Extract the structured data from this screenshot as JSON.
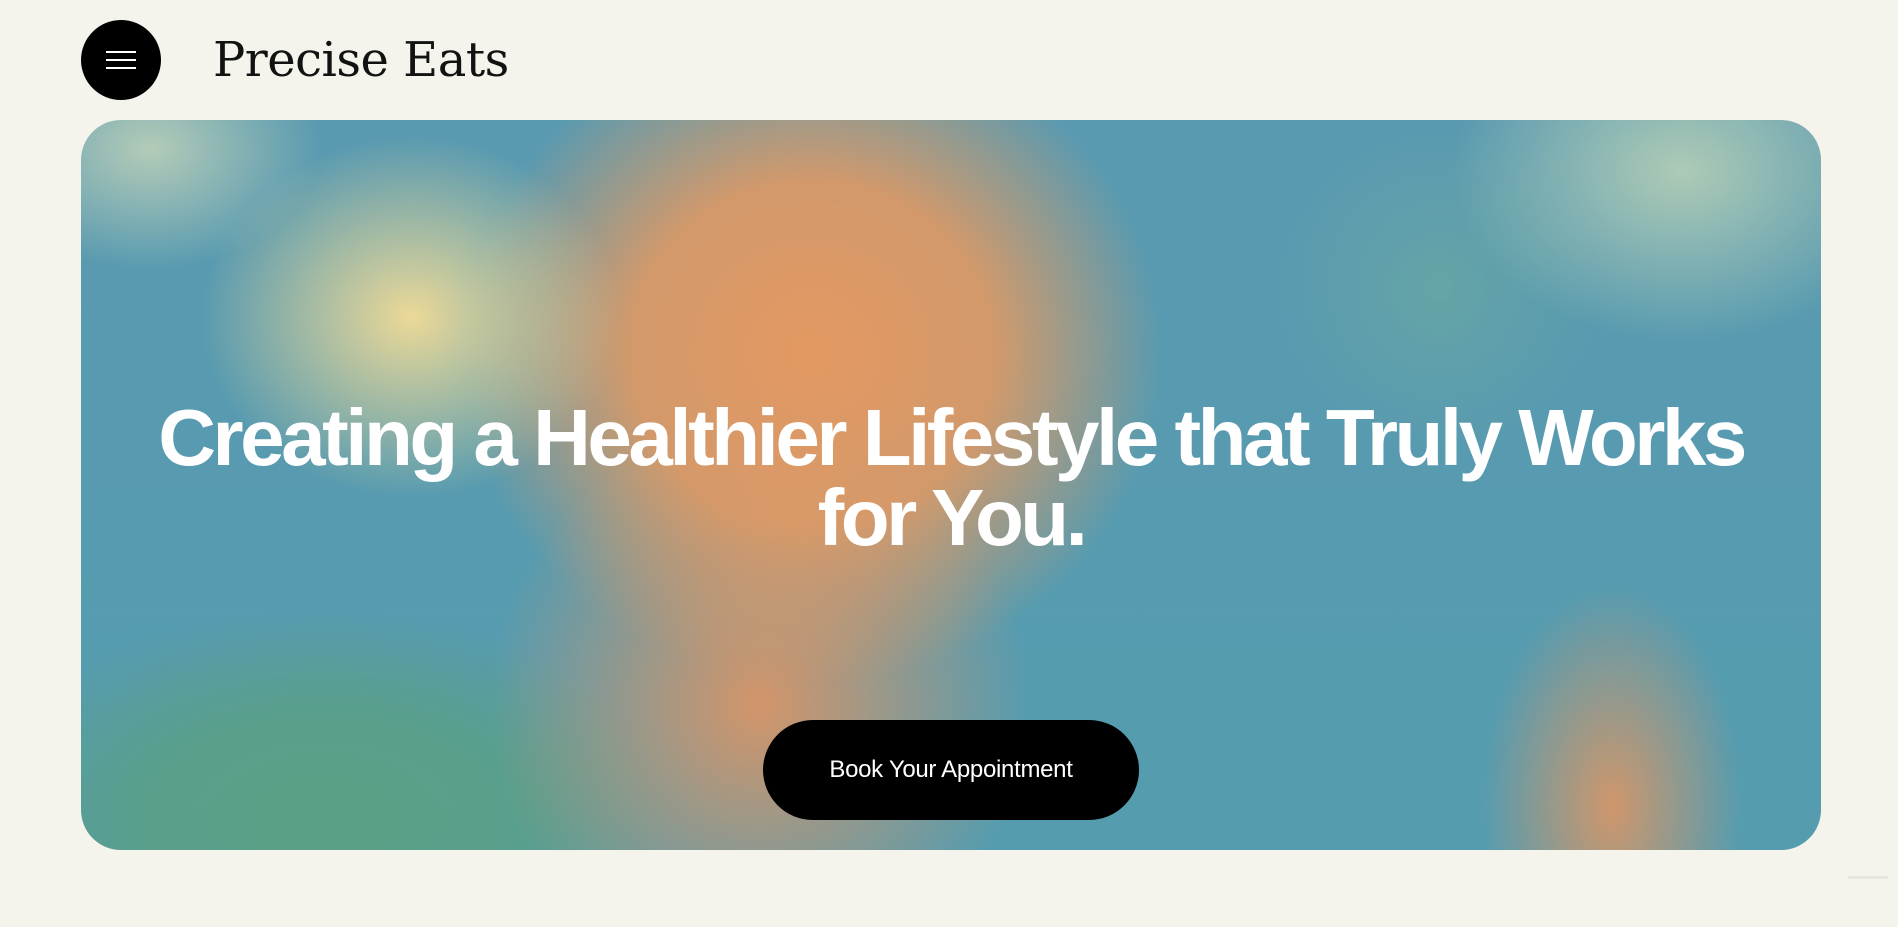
{
  "header": {
    "menu_icon": "hamburger-menu-icon",
    "logo_text": "Precise Eats"
  },
  "hero": {
    "title": "Creating a Healthier Lifestyle that Truly Works for You.",
    "cta_label": "Book Your Appointment"
  },
  "colors": {
    "page_background": "#f4f3ec",
    "menu_button": "#000000",
    "cta_button": "#000000",
    "hero_text": "#ffffff",
    "gradient_teal": "#559caf",
    "gradient_orange": "#e8995f",
    "gradient_yellow": "#f3dc96",
    "gradient_green": "#5aa082"
  }
}
